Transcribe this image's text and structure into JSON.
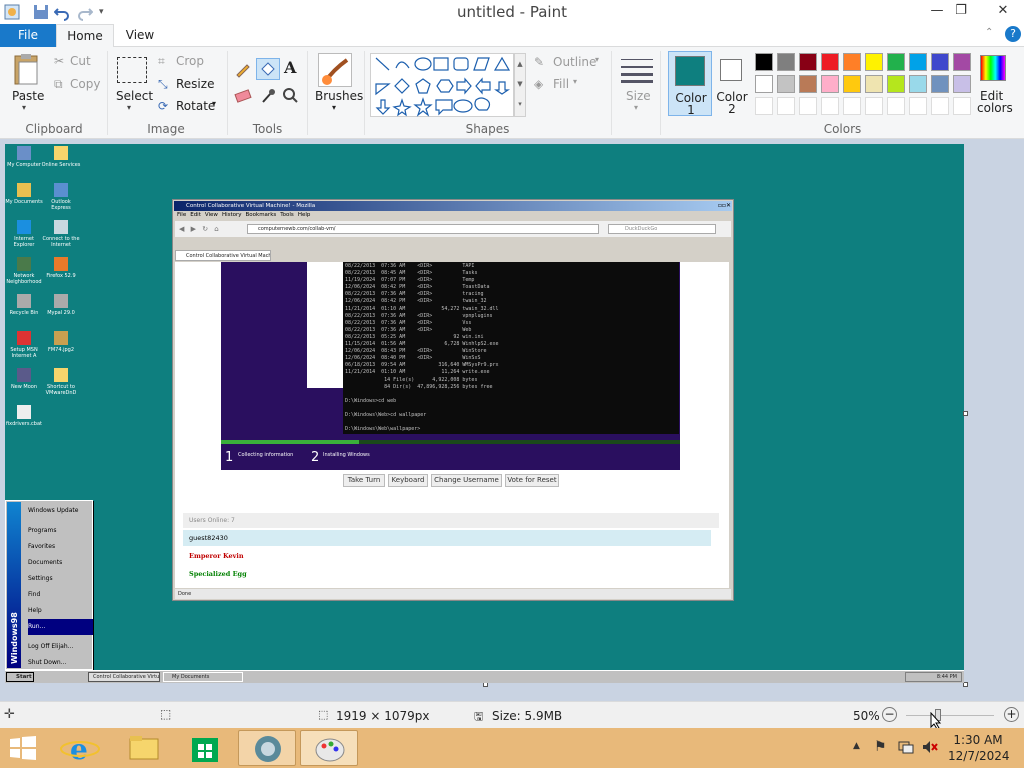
{
  "window": {
    "title": "untitled - Paint",
    "controls": [
      "—",
      "❐",
      "✕"
    ]
  },
  "tabs": {
    "file": "File",
    "home": "Home",
    "view": "View"
  },
  "ribbon": {
    "clipboard": {
      "label": "Clipboard",
      "paste": "Paste",
      "cut": "Cut",
      "copy": "Copy"
    },
    "image": {
      "label": "Image",
      "select": "Select",
      "crop": "Crop",
      "resize": "Resize",
      "rotate": "Rotate"
    },
    "tools": {
      "label": "Tools"
    },
    "brushes": "Brushes",
    "shapes": {
      "label": "Shapes",
      "outline": "Outline",
      "fill": "Fill"
    },
    "size": "Size",
    "color1": {
      "label": "Color",
      "num": "1",
      "value": "#0e7f7f"
    },
    "color2": {
      "label": "Color",
      "num": "2",
      "value": "#ffffff"
    },
    "colors_label": "Colors",
    "edit_colors": {
      "line1": "Edit",
      "line2": "colors"
    },
    "palette_row1": [
      "#000000",
      "#7f7f7f",
      "#880015",
      "#ed1c24",
      "#ff7f27",
      "#fff200",
      "#22b14c",
      "#00a2e8",
      "#3f48cc",
      "#a349a4"
    ],
    "palette_row2": [
      "#ffffff",
      "#c3c3c3",
      "#b97a57",
      "#ffaec9",
      "#ffc90e",
      "#efe4b0",
      "#b5e61d",
      "#99d9ea",
      "#7092be",
      "#c8bfe7"
    ]
  },
  "status": {
    "dimensions": "1919 × 1079px",
    "size": "Size: 5.9MB",
    "zoom": "50%",
    "zoom_value": 50
  },
  "taskbar": {
    "time": "1:30 AM",
    "date": "12/7/2024"
  },
  "screenshot": {
    "desktop_icons": [
      {
        "label": "My Computer"
      },
      {
        "label": "Online Services"
      },
      {
        "label": "My Documents"
      },
      {
        "label": "Outlook Express"
      },
      {
        "label": "Internet Explorer"
      },
      {
        "label": "Connect to the Internet"
      },
      {
        "label": "Network Neighborhood"
      },
      {
        "label": "Firefox 52.9"
      },
      {
        "label": "Recycle Bin"
      },
      {
        "label": "Mypal 29.0"
      },
      {
        "label": "Setup MSN Internet A"
      },
      {
        "label": "FM74.jpg2"
      },
      {
        "label": "New Moon"
      },
      {
        "label": "Shortcut to VMwareDnD"
      },
      {
        "label": "fixdrivers.cbat"
      }
    ],
    "browser": {
      "title": "Control Collaborative Virtual Machine! - Mozilla",
      "menu": [
        "File",
        "Edit",
        "View",
        "History",
        "Bookmarks",
        "Tools",
        "Help"
      ],
      "url": "computernewb.com/collab-vm/",
      "search": "DuckDuckGo",
      "tab": "Control Collaborative Virtual Machine!",
      "status": "Done",
      "cmd_lines": [
        "08/22/2013  07:36 AM    <DIR>          TAPI",
        "08/22/2013  08:45 AM    <DIR>          Tasks",
        "11/19/2024  07:07 PM    <DIR>          Temp",
        "12/06/2024  08:42 PM    <DIR>          ToastData",
        "08/22/2013  07:36 AM    <DIR>          tracing",
        "12/06/2024  08:42 PM    <DIR>          twain_32",
        "11/21/2014  01:10 AM            54,272 twain_32.dll",
        "08/22/2013  07:36 AM    <DIR>          vpnplugins",
        "08/22/2013  07:36 AM    <DIR>          Vss",
        "08/22/2013  07:36 AM    <DIR>          Web",
        "08/22/2013  05:25 AM                92 win.ini",
        "11/15/2014  01:56 AM             6,728 WinhlpS2.exe",
        "12/06/2024  08:43 PM    <DIR>          WinStore",
        "12/06/2024  08:40 PM    <DIR>          WinSxS",
        "06/18/2013  09:54 AM           316,640 WMSysPr9.prx",
        "11/21/2014  01:10 AM            11,264 write.exe",
        "             14 File(s)      4,922,008 bytes",
        "             84 Dir(s)  47,896,928,256 bytes free",
        "",
        "D:\\Windows>cd web",
        "",
        "D:\\Windows\\Web>cd wallpaper",
        "",
        "D:\\Windows\\Web\\wallpaper>"
      ],
      "setup_steps": [
        {
          "num": "1",
          "label": "Collecting information"
        },
        {
          "num": "2",
          "label": "Installing Windows"
        }
      ],
      "buttons": [
        "Take Turn",
        "Keyboard",
        "Change Username",
        "Vote for Reset"
      ],
      "users_online": "Users Online: 7",
      "users": [
        {
          "name": "guest82430",
          "color": "#000000"
        },
        {
          "name": "Emperor Kevin",
          "color": "#c00000"
        },
        {
          "name": "Specialized Egg",
          "color": "#008000"
        }
      ]
    },
    "startmenu": {
      "brand": "Windows98",
      "items": [
        "Windows Update",
        "Programs",
        "Favorites",
        "Documents",
        "Settings",
        "Find",
        "Help",
        "Run...",
        "Log Off Elijah...",
        "Shut Down..."
      ]
    },
    "win98_taskbar": {
      "start": "Start",
      "items": [
        "Control Collaborative Virtua...",
        "My Documents"
      ],
      "clock": "8:44 PM"
    }
  }
}
